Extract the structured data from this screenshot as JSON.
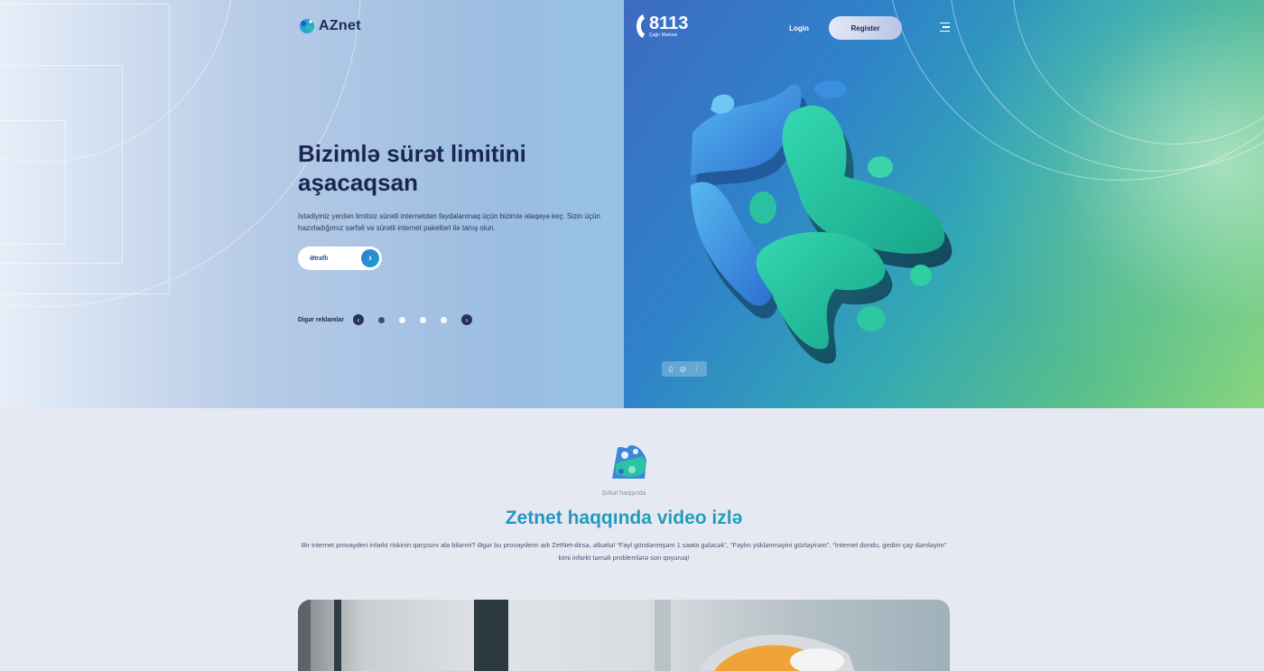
{
  "header": {
    "logo_text": "AZnet",
    "phone": {
      "number": "8113",
      "label": "Çağrı Mərkəzi"
    },
    "login_label": "Login",
    "register_label": "Register"
  },
  "hero": {
    "title": "Bizimlə sürət limitini aşacaqsan",
    "description": "İstədiyiniz yerdən limitsiz sürətli internetdən faydalanmaq üçün bizimlə əlaqəyə keç. Sizin üçün hazırladığımız sərfəli və sürətli internet paketləri ilə tanış olun.",
    "more_label": "Ətraflı",
    "ads_label": "Digər reklamlar",
    "slides": {
      "total": 4,
      "active": 1
    }
  },
  "about": {
    "kicker": "Şirkət haqqında",
    "title": "Zetnet haqqında video izlə",
    "description": "Bir internet provayderi infarkt riskinin qarşısını ala bilərmi? Əgər bu provayderin adı ZetNet-dirsə, əlbəttə! “Fayl göndərmişəm 1 saata gələcək”, “Faylın yüklənməyini gözləyirəm”, “İnternet dondu, gedim çay dəmləyim” kimi infarkt təməli problemlərə son qoyuruq!"
  },
  "icons": [
    "logo-icon",
    "phone-icon",
    "menu-icon",
    "arrow-right-icon",
    "arrow-left-icon",
    "bookmark-icon",
    "settings-icon",
    "more-vertical-icon"
  ],
  "colors": {
    "brand_blue": "#2a7fe0",
    "brand_green": "#19b59a",
    "dark_navy": "#1b2650"
  }
}
